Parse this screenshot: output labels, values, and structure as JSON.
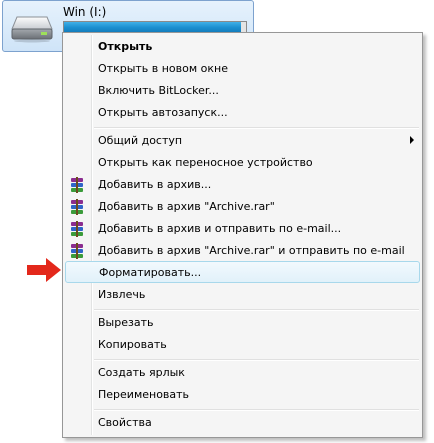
{
  "drive": {
    "label": "Win (I:)",
    "usage_fraction": 0.97,
    "icon": "drive-icon",
    "bar_color": "#1a8fd0"
  },
  "menu": {
    "items": [
      {
        "label": "Открыть",
        "bold": true
      },
      {
        "label": "Открыть в новом окне"
      },
      {
        "label": "Включить BitLocker..."
      },
      {
        "label": "Открыть автозапуск..."
      },
      {
        "label": "Общий доступ",
        "submenu": true
      },
      {
        "label": "Открыть как переносное устройство"
      },
      {
        "label": "Добавить в архив...",
        "icon": "winrar-icon"
      },
      {
        "label": "Добавить в архив \"Archive.rar\"",
        "icon": "winrar-icon"
      },
      {
        "label": "Добавить в архив и отправить по e-mail...",
        "icon": "winrar-icon"
      },
      {
        "label": "Добавить в архив \"Archive.rar\" и отправить по e-mail",
        "icon": "winrar-icon"
      },
      {
        "label": "Форматировать...",
        "highlighted": true
      },
      {
        "label": "Извлечь"
      },
      {
        "label": "Вырезать"
      },
      {
        "label": "Копировать"
      },
      {
        "label": "Создать ярлык"
      },
      {
        "label": "Переименовать"
      },
      {
        "label": "Свойства"
      }
    ]
  },
  "pointer": {
    "icon": "red-arrow-icon",
    "color": "#e3281b"
  },
  "colors": {
    "menu_bg": "#f5f5f5",
    "highlight_border": "#a8d8eb"
  }
}
